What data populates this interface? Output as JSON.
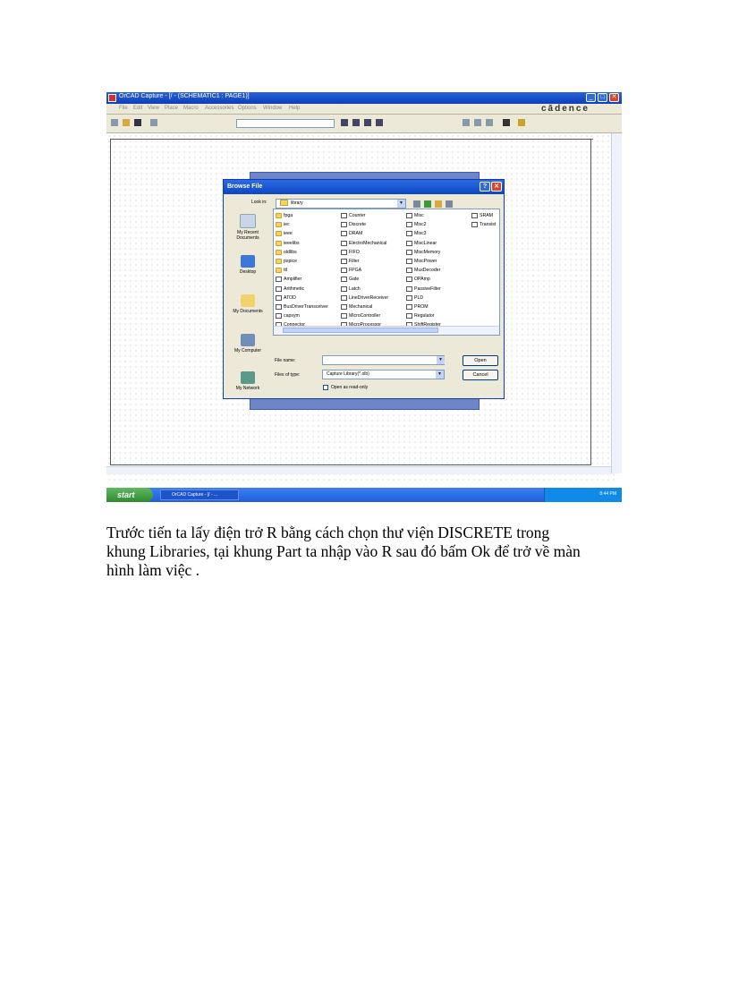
{
  "window": {
    "title": "OrCAD Capture - [/ - (SCHEMATIC1 : PAGE1)]",
    "brand": "cādence",
    "menu": [
      "File",
      "Edit",
      "View",
      "Place",
      "Macro",
      "Accessories",
      "Options",
      "Window",
      "Help"
    ],
    "controls": {
      "minimize": "_",
      "maximize": "□",
      "close": "✕"
    }
  },
  "dialog": {
    "title": "Browse File",
    "help": "?",
    "close": "✕",
    "look_in_label": "Look in:",
    "look_in_value": "library",
    "places": [
      "My Recent Documents",
      "Desktop",
      "My Documents",
      "My Computer",
      "My Network"
    ],
    "columns": [
      [
        {
          "name": "fpga",
          "type": "folder"
        },
        {
          "name": "iec",
          "type": "folder"
        },
        {
          "name": "ieee",
          "type": "folder"
        },
        {
          "name": "ieeelibs",
          "type": "folder"
        },
        {
          "name": "oldlibs",
          "type": "folder"
        },
        {
          "name": "pspice",
          "type": "folder"
        },
        {
          "name": "ttl",
          "type": "folder"
        },
        {
          "name": "Amplifier",
          "type": "file"
        },
        {
          "name": "Arithmetic",
          "type": "file"
        },
        {
          "name": "ATOD",
          "type": "file"
        },
        {
          "name": "BusDriverTransceiver",
          "type": "file"
        },
        {
          "name": "capsym",
          "type": "file"
        },
        {
          "name": "Connector",
          "type": "file"
        }
      ],
      [
        {
          "name": "Counter",
          "type": "file"
        },
        {
          "name": "Discrete",
          "type": "file"
        },
        {
          "name": "DRAM",
          "type": "file"
        },
        {
          "name": "ElectroMechanical",
          "type": "file"
        },
        {
          "name": "FIFO",
          "type": "file"
        },
        {
          "name": "Filter",
          "type": "file"
        },
        {
          "name": "FPGA",
          "type": "file"
        },
        {
          "name": "Gate",
          "type": "file"
        },
        {
          "name": "Latch",
          "type": "file"
        },
        {
          "name": "LineDriverReceiver",
          "type": "file"
        },
        {
          "name": "Mechanical",
          "type": "file"
        },
        {
          "name": "MicroController",
          "type": "file"
        },
        {
          "name": "MicroProcessor",
          "type": "file"
        }
      ],
      [
        {
          "name": "Misc",
          "type": "file"
        },
        {
          "name": "Misc2",
          "type": "file"
        },
        {
          "name": "Misc3",
          "type": "file"
        },
        {
          "name": "MiscLinear",
          "type": "file"
        },
        {
          "name": "MiscMemory",
          "type": "file"
        },
        {
          "name": "MiscPower",
          "type": "file"
        },
        {
          "name": "MuxDecoder",
          "type": "file"
        },
        {
          "name": "OPAmp",
          "type": "file"
        },
        {
          "name": "PassiveFilter",
          "type": "file"
        },
        {
          "name": "PLD",
          "type": "file"
        },
        {
          "name": "PROM",
          "type": "file"
        },
        {
          "name": "Regulator",
          "type": "file"
        },
        {
          "name": "ShiftRegister",
          "type": "file"
        }
      ],
      [
        {
          "name": "SRAM",
          "type": "file"
        },
        {
          "name": "Transist",
          "type": "file"
        }
      ]
    ],
    "file_name_label": "File name:",
    "file_name_value": "",
    "files_of_type_label": "Files of type:",
    "files_of_type_value": "Capture Library(*.olb)",
    "read_only_label": "Open as read-only",
    "open_button": "Open",
    "cancel_button": "Cancel"
  },
  "taskbar": {
    "start": "start",
    "task": "OrCAD Capture - [/ - ...",
    "clock": "8:44 PM"
  },
  "caption": {
    "line1": "Trước tiến ta lấy  điện trở R bằng cách chọn thư viện DISCRETE  trong",
    "line2": "khung Libraries, tại khung Part ta nhập vào R sau đó bấm Ok để trở về màn",
    "line3": "hình làm việc ."
  },
  "colors": {
    "titlebar": "#0c47c4",
    "taskbar": "#1f5ed8",
    "start": "#2f8a2f",
    "folder": "#f4d35e"
  }
}
